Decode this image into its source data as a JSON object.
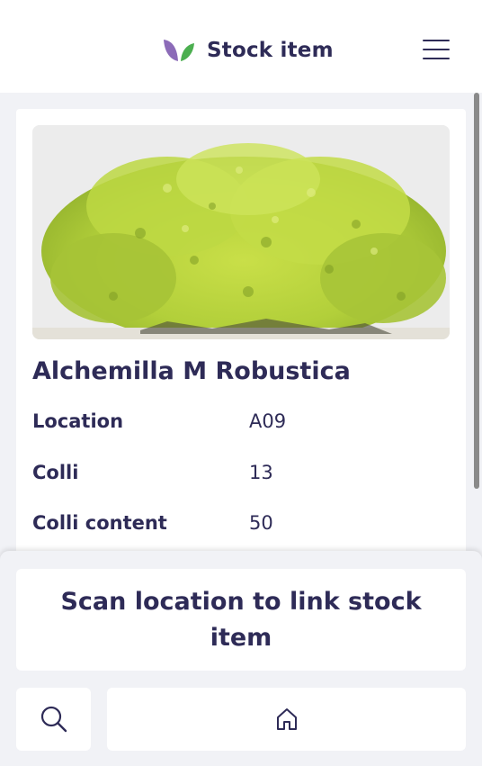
{
  "header": {
    "title": "Stock item",
    "logo_icon": "leaf-logo-icon",
    "menu_icon": "hamburger-menu-icon"
  },
  "item": {
    "image_icon": "plant-photo",
    "name": "Alchemilla M Robustica",
    "details": [
      {
        "label": "Location",
        "value": "A09"
      },
      {
        "label": "Colli",
        "value": "13"
      },
      {
        "label": "Colli content",
        "value": "50"
      }
    ]
  },
  "actions": {
    "scan_prompt": "Scan location to link stock item",
    "search_icon": "search-icon",
    "home_icon": "home-icon"
  },
  "colors": {
    "primary": "#2e2b57",
    "leaf_purple": "#8c6bb8",
    "leaf_green": "#4caf50",
    "background": "#f1f2f6"
  }
}
